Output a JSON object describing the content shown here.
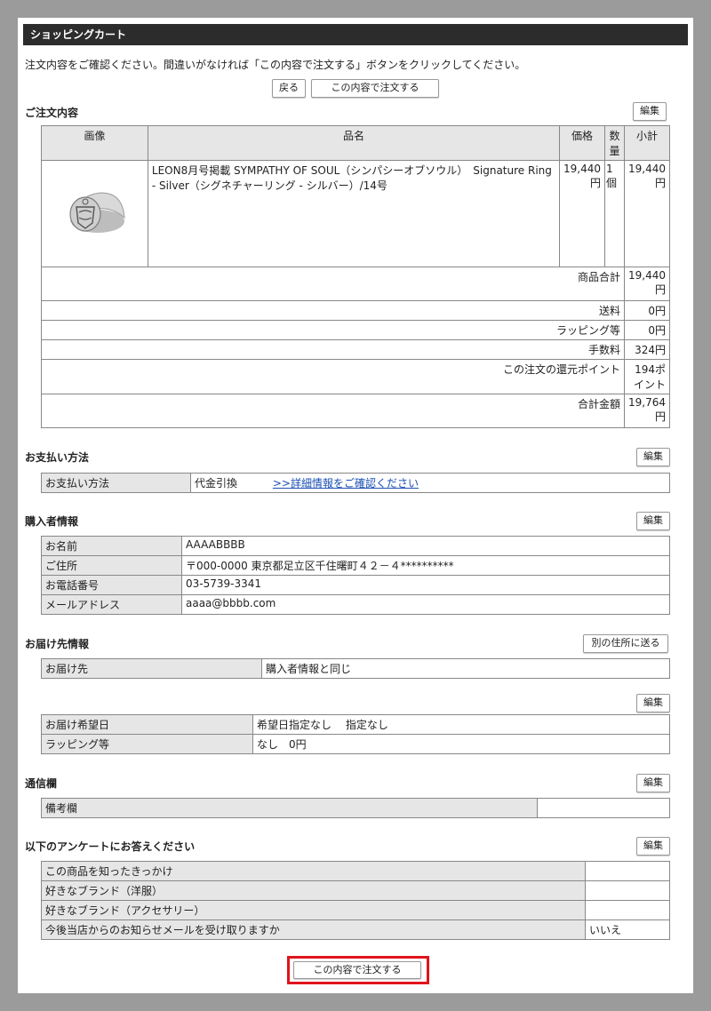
{
  "header": {
    "title": "ショッピングカート"
  },
  "intro": {
    "text": "注文内容をご確認ください。間違いがなければ「この内容で注文する」ボタンをクリックしてください。"
  },
  "top_buttons": {
    "back": "戻る",
    "submit": "この内容で注文する"
  },
  "order": {
    "title": "ご注文内容",
    "edit": "編集",
    "columns": {
      "image": "画像",
      "name": "品名",
      "price": "価格",
      "qty": "数量",
      "subtotal": "小計"
    },
    "item": {
      "name": "LEON8月号掲載 SYMPATHY OF SOUL（シンパシーオブソウル）　Signature Ring - Silver（シグネチャーリング - シルバー）/14号",
      "price": "19,440円",
      "qty": "1個",
      "subtotal": "19,440円"
    },
    "summary": [
      {
        "label": "商品合計",
        "value": "19,440円"
      },
      {
        "label": "送料",
        "value": "0円"
      },
      {
        "label": "ラッピング等",
        "value": "0円"
      },
      {
        "label": "手数料",
        "value": "324円"
      },
      {
        "label": "この注文の還元ポイント",
        "value": "194ポイント"
      },
      {
        "label": "合計金額",
        "value": "19,764円"
      }
    ]
  },
  "payment": {
    "title": "お支払い方法",
    "edit": "編集",
    "label": "お支払い方法",
    "value": "代金引換",
    "link": ">>詳細情報をご確認ください"
  },
  "buyer": {
    "title": "購入者情報",
    "edit": "編集",
    "rows": [
      {
        "label": "お名前",
        "value": "AAAABBBB"
      },
      {
        "label": "ご住所",
        "value": "〒000-0000 東京都足立区千住曙町４２－４**********"
      },
      {
        "label": "お電話番号",
        "value": "03-5739-3341"
      },
      {
        "label": "メールアドレス",
        "value": "aaaa@bbbb.com"
      }
    ]
  },
  "delivery": {
    "title": "お届け先情報",
    "other_address": "別の住所に送る",
    "dest_label": "お届け先",
    "dest_value": "購入者情報と同じ",
    "edit": "編集",
    "rows": [
      {
        "label": "お届け希望日",
        "value": "希望日指定なし　 指定なし"
      },
      {
        "label": "ラッピング等",
        "value": "なし　0円"
      }
    ]
  },
  "memo": {
    "title": "通信欄",
    "edit": "編集",
    "label": "備考欄",
    "value": ""
  },
  "survey": {
    "title": "以下のアンケートにお答えください",
    "edit": "編集",
    "rows": [
      {
        "label": "この商品を知ったきっかけ",
        "value": ""
      },
      {
        "label": "好きなブランド（洋服）",
        "value": ""
      },
      {
        "label": "好きなブランド（アクセサリー）",
        "value": ""
      },
      {
        "label": "今後当店からのお知らせメールを受け取りますか",
        "value": "いいえ"
      }
    ]
  },
  "bottom": {
    "submit": "この内容で注文する"
  },
  "colors": {
    "header_bg": "#2c2c2c",
    "label_bg": "#e6e6e6",
    "highlight": "#e0141b",
    "link": "#1a4fb3"
  }
}
